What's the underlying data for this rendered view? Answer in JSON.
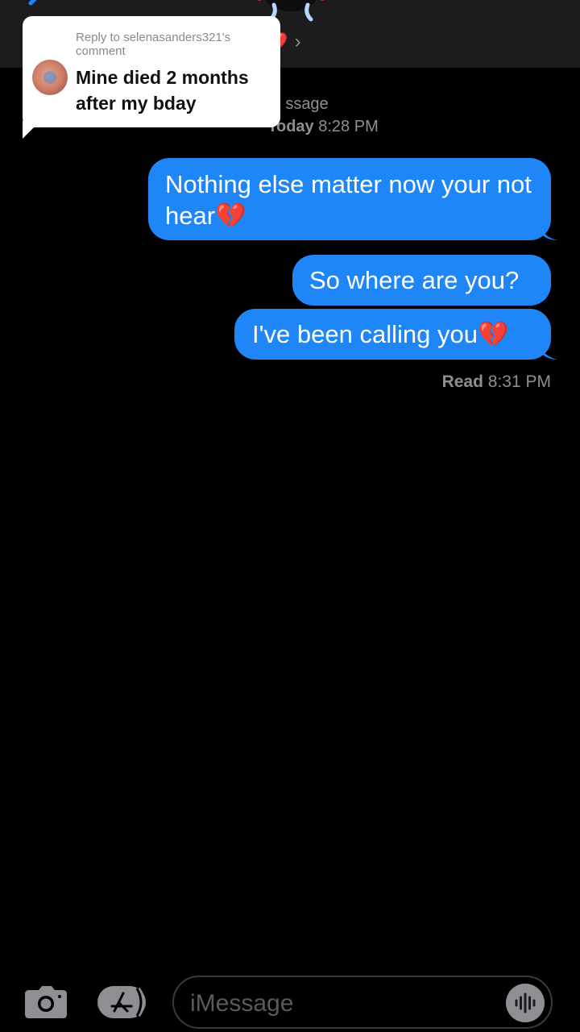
{
  "header": {
    "contact_name": "d💔",
    "contact_chevron": "›",
    "icons": {
      "back": "chevron-left-icon",
      "video": "video-camera-icon"
    },
    "accent_color": "#1f86f8"
  },
  "reply_card": {
    "label": "Reply to selenasanders321's comment",
    "text": "Mine died 2 months after my bday"
  },
  "conversation": {
    "service": "ssage",
    "timestamp_day": "Today",
    "timestamp_time": "8:28 PM",
    "messages": [
      {
        "text": "Nothing else matter now your not hear💔",
        "sent": true
      },
      {
        "text": "So where are you?",
        "sent": true
      },
      {
        "text": "I've been calling you💔",
        "sent": true
      }
    ],
    "read_label": "Read",
    "read_time": "8:31 PM",
    "bubble_color": "#1f86f8"
  },
  "input_bar": {
    "placeholder": "iMessage",
    "icons": {
      "camera": "camera-icon",
      "apps": "app-store-icon",
      "audio": "audio-waveform-icon"
    }
  }
}
